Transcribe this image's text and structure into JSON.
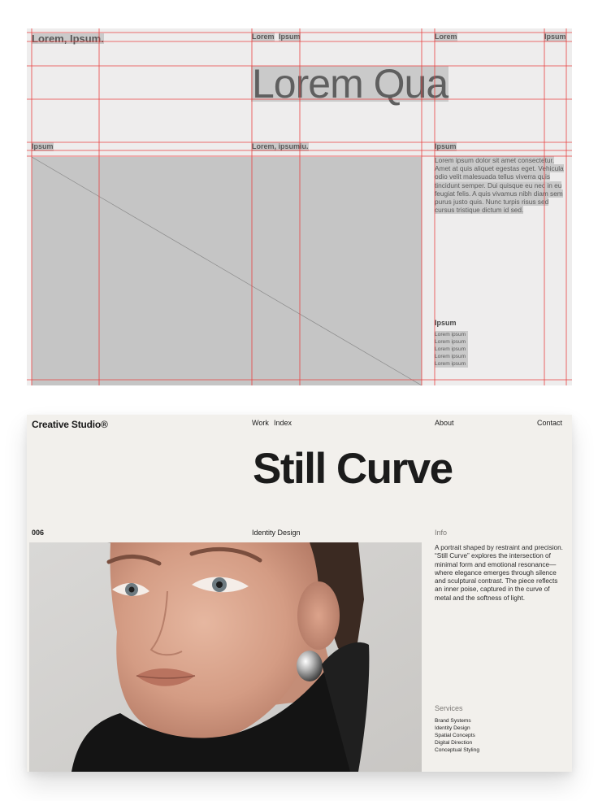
{
  "wireframe": {
    "logo": "Lorem, Ipsum.",
    "nav_left_1": "Lorem",
    "nav_left_2": "Ipsum",
    "nav_about": "Lorem",
    "nav_contact": "Ipsum",
    "title": "Lorem Qua",
    "index": "Ipsum",
    "category": "Lorem, ipsumiu.",
    "info_label": "Ipsum",
    "description": "Lorem ipsum dolor sit amet consectetur. Amet at quis aliquet egestas eget. Vehicula odio velit malesuada tellus viverra quis tincidunt semper. Dui quisque eu nec in eu feugiat felis. A quis vivamus nibh diam sem purus justo quis. Nunc turpis risus sed cursus tristique dictum id sed.",
    "list_label": "Ipsum",
    "list_items": [
      "Lorem ipsum",
      "Lorem ipsum",
      "Lorem ipsum",
      "Lorem ipsum",
      "Lorem ipsum"
    ]
  },
  "website": {
    "logo": "Creative Studio®",
    "nav_work": "Work",
    "nav_index": "Index",
    "nav_about": "About",
    "nav_contact": "Contact",
    "title": "Still Curve",
    "project_number": "006",
    "category": "Identity Design",
    "info_label": "Info",
    "description": "A portrait shaped by restraint and precision. “Still Curve” explores the intersection of minimal form and emotional resonance—where elegance emerges through silence and sculptural contrast. The piece reflects an inner poise, captured in the curve of metal and the softness of light.",
    "services_label": "Services",
    "services": [
      "Brand Systems",
      "Identity Design",
      "Spatial Concepts",
      "Digital Direction",
      "Conceptual Styling"
    ]
  },
  "colors": {
    "guide": "#e8403f",
    "wireframe_bg": "#eeeded",
    "placeholder": "#c5c5c5",
    "site_bg": "#f2f0ec",
    "text": "#1b1b1b"
  }
}
